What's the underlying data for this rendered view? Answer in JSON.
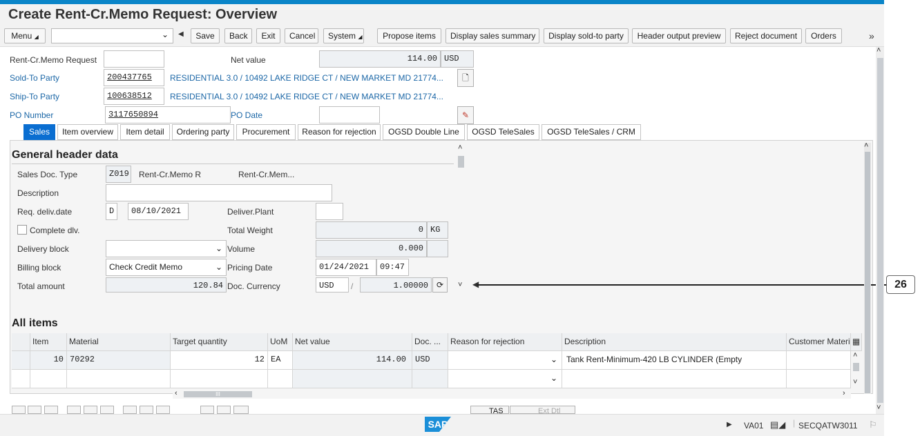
{
  "title": "Create Rent-Cr.Memo Request: Overview",
  "toolbar": {
    "menu": "Menu",
    "save": "Save",
    "back": "Back",
    "exit": "Exit",
    "cancel": "Cancel",
    "system": "System",
    "propose_items": "Propose items",
    "display_sales_summary": "Display sales summary",
    "display_sold_to_party": "Display sold-to party",
    "header_output_preview": "Header output preview",
    "reject_document": "Reject document",
    "orders": "Orders",
    "more": "»"
  },
  "header": {
    "rent_cr_memo_label": "Rent-Cr.Memo Request",
    "rent_cr_memo_value": "",
    "net_value_label": "Net value",
    "net_value": "114.00",
    "net_value_currency": "USD",
    "sold_to_label": "Sold-To Party",
    "sold_to_value": "200437765",
    "sold_to_desc": "RESIDENTIAL 3.0 / 10492 LAKE RIDGE CT / NEW MARKET MD 21774...",
    "ship_to_label": "Ship-To Party",
    "ship_to_value": "100638512",
    "ship_to_desc": "RESIDENTIAL 3.0 / 10492 LAKE RIDGE CT / NEW MARKET MD 21774...",
    "po_number_label": "PO Number",
    "po_number_value": "3117650894",
    "po_date_label": "PO Date",
    "po_date_value": ""
  },
  "tabs": [
    "Sales",
    "Item overview",
    "Item detail",
    "Ordering party",
    "Procurement",
    "Reason for rejection",
    "OGSD Double Line",
    "OGSD TeleSales",
    "OGSD TeleSales / CRM"
  ],
  "general": {
    "section_title": "General header data",
    "sales_doc_type_label": "Sales Doc. Type",
    "sales_doc_type_value": "Z019",
    "sales_doc_type_desc1": "Rent-Cr.Memo R",
    "sales_doc_type_desc2": "Rent-Cr.Mem...",
    "description_label": "Description",
    "description_value": "",
    "req_deliv_label": "Req. deliv.date",
    "req_deliv_period": "D",
    "req_deliv_value": "08/10/2021",
    "deliver_plant_label": "Deliver.Plant",
    "deliver_plant_value": "",
    "complete_dlv_label": "Complete dlv.",
    "total_weight_label": "Total Weight",
    "total_weight_value": "0",
    "total_weight_unit": "KG",
    "delivery_block_label": "Delivery block",
    "delivery_block_value": "",
    "volume_label": "Volume",
    "volume_value": "0.000",
    "billing_block_label": "Billing block",
    "billing_block_value": "Check Credit Memo",
    "pricing_date_label": "Pricing Date",
    "pricing_date_value": "01/24/2021",
    "pricing_time_value": "09:47",
    "total_amount_label": "Total amount",
    "total_amount_value": "120.84",
    "doc_currency_label": "Doc. Currency",
    "doc_currency_value": "USD",
    "doc_currency_sep": "/",
    "exchange_rate_value": "1.00000"
  },
  "items": {
    "section_title": "All items",
    "columns": [
      "Item",
      "Material",
      "Target quantity",
      "UoM",
      "Net value",
      "Doc. ...",
      "Reason for rejection",
      "Description",
      "Customer Materi"
    ],
    "rows": [
      {
        "item": "10",
        "material": "70292",
        "qty": "12",
        "uom": "EA",
        "net": "114.00",
        "curr": "USD",
        "reason": "",
        "desc": "Tank Rent-Minimum-420 LB CYLINDER (Empty",
        "cust": ""
      },
      {
        "item": "",
        "material": "",
        "qty": "",
        "uom": "",
        "net": "",
        "curr": "",
        "reason": "",
        "desc": "",
        "cust": ""
      }
    ],
    "scroll_label": "III"
  },
  "bottom_buttons": {
    "tas": "TAS",
    "ext_dtl": "Ext Dtl"
  },
  "status": {
    "logo": "SAP",
    "transaction": "VA01",
    "system": "SECQATW3011"
  },
  "callout": "26"
}
